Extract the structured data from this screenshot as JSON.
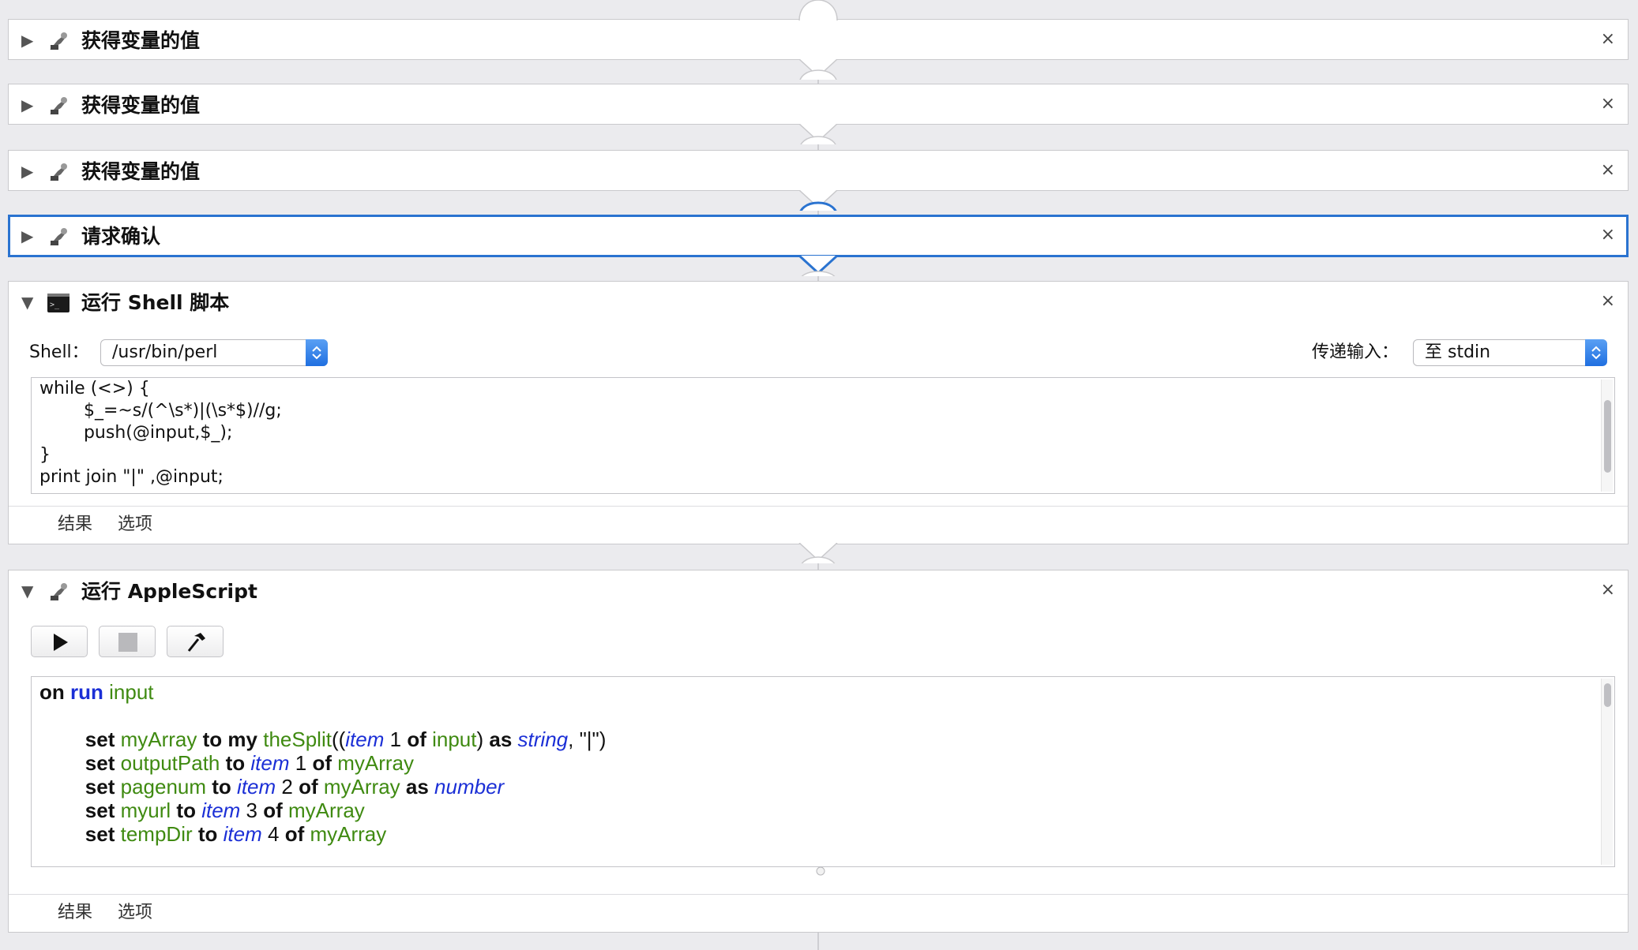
{
  "actions": {
    "get_var_1": {
      "title": "获得变量的值",
      "close": "×",
      "disclosure": "▶",
      "icon": "automator-robot-icon"
    },
    "get_var_2": {
      "title": "获得变量的值",
      "close": "×",
      "disclosure": "▶",
      "icon": "automator-robot-icon"
    },
    "get_var_3": {
      "title": "获得变量的值",
      "close": "×",
      "disclosure": "▶",
      "icon": "automator-robot-icon"
    },
    "ask_confirm": {
      "title": "请求确认",
      "close": "×",
      "disclosure": "▶",
      "icon": "automator-robot-icon"
    },
    "shell": {
      "title": "运行 Shell 脚本",
      "close": "×",
      "disclosure": "▼",
      "icon": "terminal-icon",
      "shell_label": "Shell：",
      "shell_value": "/usr/bin/perl",
      "pass_input_label": "传递输入：",
      "pass_input_value": "至 stdin",
      "code": [
        "while (<>) {",
        "        $_=~s/(^\\s*)|(\\s*$)//g;",
        "        push(@input,$_);",
        "}",
        "print join \"|\" ,@input;"
      ],
      "tabs": [
        "结果",
        "选项"
      ]
    },
    "applescript": {
      "title": "运行 AppleScript",
      "close": "×",
      "disclosure": "▼",
      "icon": "automator-robot-icon",
      "toolbar": [
        "run-icon",
        "stop-icon",
        "compile-hammer-icon"
      ],
      "code": [
        [
          {
            "t": "on",
            "c": "kw"
          },
          {
            "t": " ",
            "c": "pl"
          },
          {
            "t": "run",
            "c": "kb"
          },
          {
            "t": " ",
            "c": "pl"
          },
          {
            "t": "input",
            "c": "vg"
          }
        ],
        [],
        [
          {
            "t": "        ",
            "c": "pl"
          },
          {
            "t": "set",
            "c": "kw"
          },
          {
            "t": " ",
            "c": "pl"
          },
          {
            "t": "myArray",
            "c": "vg"
          },
          {
            "t": " ",
            "c": "pl"
          },
          {
            "t": "to",
            "c": "kw"
          },
          {
            "t": " ",
            "c": "pl"
          },
          {
            "t": "my",
            "c": "kw"
          },
          {
            "t": " ",
            "c": "pl"
          },
          {
            "t": "theSplit",
            "c": "vg"
          },
          {
            "t": "((",
            "c": "pl"
          },
          {
            "t": "item",
            "c": "ci"
          },
          {
            "t": " 1 ",
            "c": "pl"
          },
          {
            "t": "of",
            "c": "kw"
          },
          {
            "t": " ",
            "c": "pl"
          },
          {
            "t": "input",
            "c": "vg"
          },
          {
            "t": ") ",
            "c": "pl"
          },
          {
            "t": "as",
            "c": "kw"
          },
          {
            "t": " ",
            "c": "pl"
          },
          {
            "t": "string",
            "c": "ci"
          },
          {
            "t": ", \"|\")",
            "c": "pl"
          }
        ],
        [
          {
            "t": "        ",
            "c": "pl"
          },
          {
            "t": "set",
            "c": "kw"
          },
          {
            "t": " ",
            "c": "pl"
          },
          {
            "t": "outputPath",
            "c": "vg"
          },
          {
            "t": " ",
            "c": "pl"
          },
          {
            "t": "to",
            "c": "kw"
          },
          {
            "t": " ",
            "c": "pl"
          },
          {
            "t": "item",
            "c": "ci"
          },
          {
            "t": " 1 ",
            "c": "pl"
          },
          {
            "t": "of",
            "c": "kw"
          },
          {
            "t": " ",
            "c": "pl"
          },
          {
            "t": "myArray",
            "c": "vg"
          }
        ],
        [
          {
            "t": "        ",
            "c": "pl"
          },
          {
            "t": "set",
            "c": "kw"
          },
          {
            "t": " ",
            "c": "pl"
          },
          {
            "t": "pagenum",
            "c": "vg"
          },
          {
            "t": " ",
            "c": "pl"
          },
          {
            "t": "to",
            "c": "kw"
          },
          {
            "t": " ",
            "c": "pl"
          },
          {
            "t": "item",
            "c": "ci"
          },
          {
            "t": " 2 ",
            "c": "pl"
          },
          {
            "t": "of",
            "c": "kw"
          },
          {
            "t": " ",
            "c": "pl"
          },
          {
            "t": "myArray",
            "c": "vg"
          },
          {
            "t": " ",
            "c": "pl"
          },
          {
            "t": "as",
            "c": "kw"
          },
          {
            "t": " ",
            "c": "pl"
          },
          {
            "t": "number",
            "c": "ci"
          }
        ],
        [
          {
            "t": "        ",
            "c": "pl"
          },
          {
            "t": "set",
            "c": "kw"
          },
          {
            "t": " ",
            "c": "pl"
          },
          {
            "t": "myurl",
            "c": "vg"
          },
          {
            "t": " ",
            "c": "pl"
          },
          {
            "t": "to",
            "c": "kw"
          },
          {
            "t": " ",
            "c": "pl"
          },
          {
            "t": "item",
            "c": "ci"
          },
          {
            "t": " 3 ",
            "c": "pl"
          },
          {
            "t": "of",
            "c": "kw"
          },
          {
            "t": " ",
            "c": "pl"
          },
          {
            "t": "myArray",
            "c": "vg"
          }
        ],
        [
          {
            "t": "        ",
            "c": "pl"
          },
          {
            "t": "set",
            "c": "kw"
          },
          {
            "t": " ",
            "c": "pl"
          },
          {
            "t": "tempDir",
            "c": "vg"
          },
          {
            "t": " ",
            "c": "pl"
          },
          {
            "t": "to",
            "c": "kw"
          },
          {
            "t": " ",
            "c": "pl"
          },
          {
            "t": "item",
            "c": "ci"
          },
          {
            "t": " 4 ",
            "c": "pl"
          },
          {
            "t": "of",
            "c": "kw"
          },
          {
            "t": " ",
            "c": "pl"
          },
          {
            "t": "myArray",
            "c": "vg"
          }
        ]
      ],
      "tabs": [
        "结果",
        "选项"
      ]
    }
  },
  "colors": {
    "selected_border": "#2a73d0",
    "keyword_blue": "#1b2fd6",
    "variable_green": "#3f8a11"
  }
}
